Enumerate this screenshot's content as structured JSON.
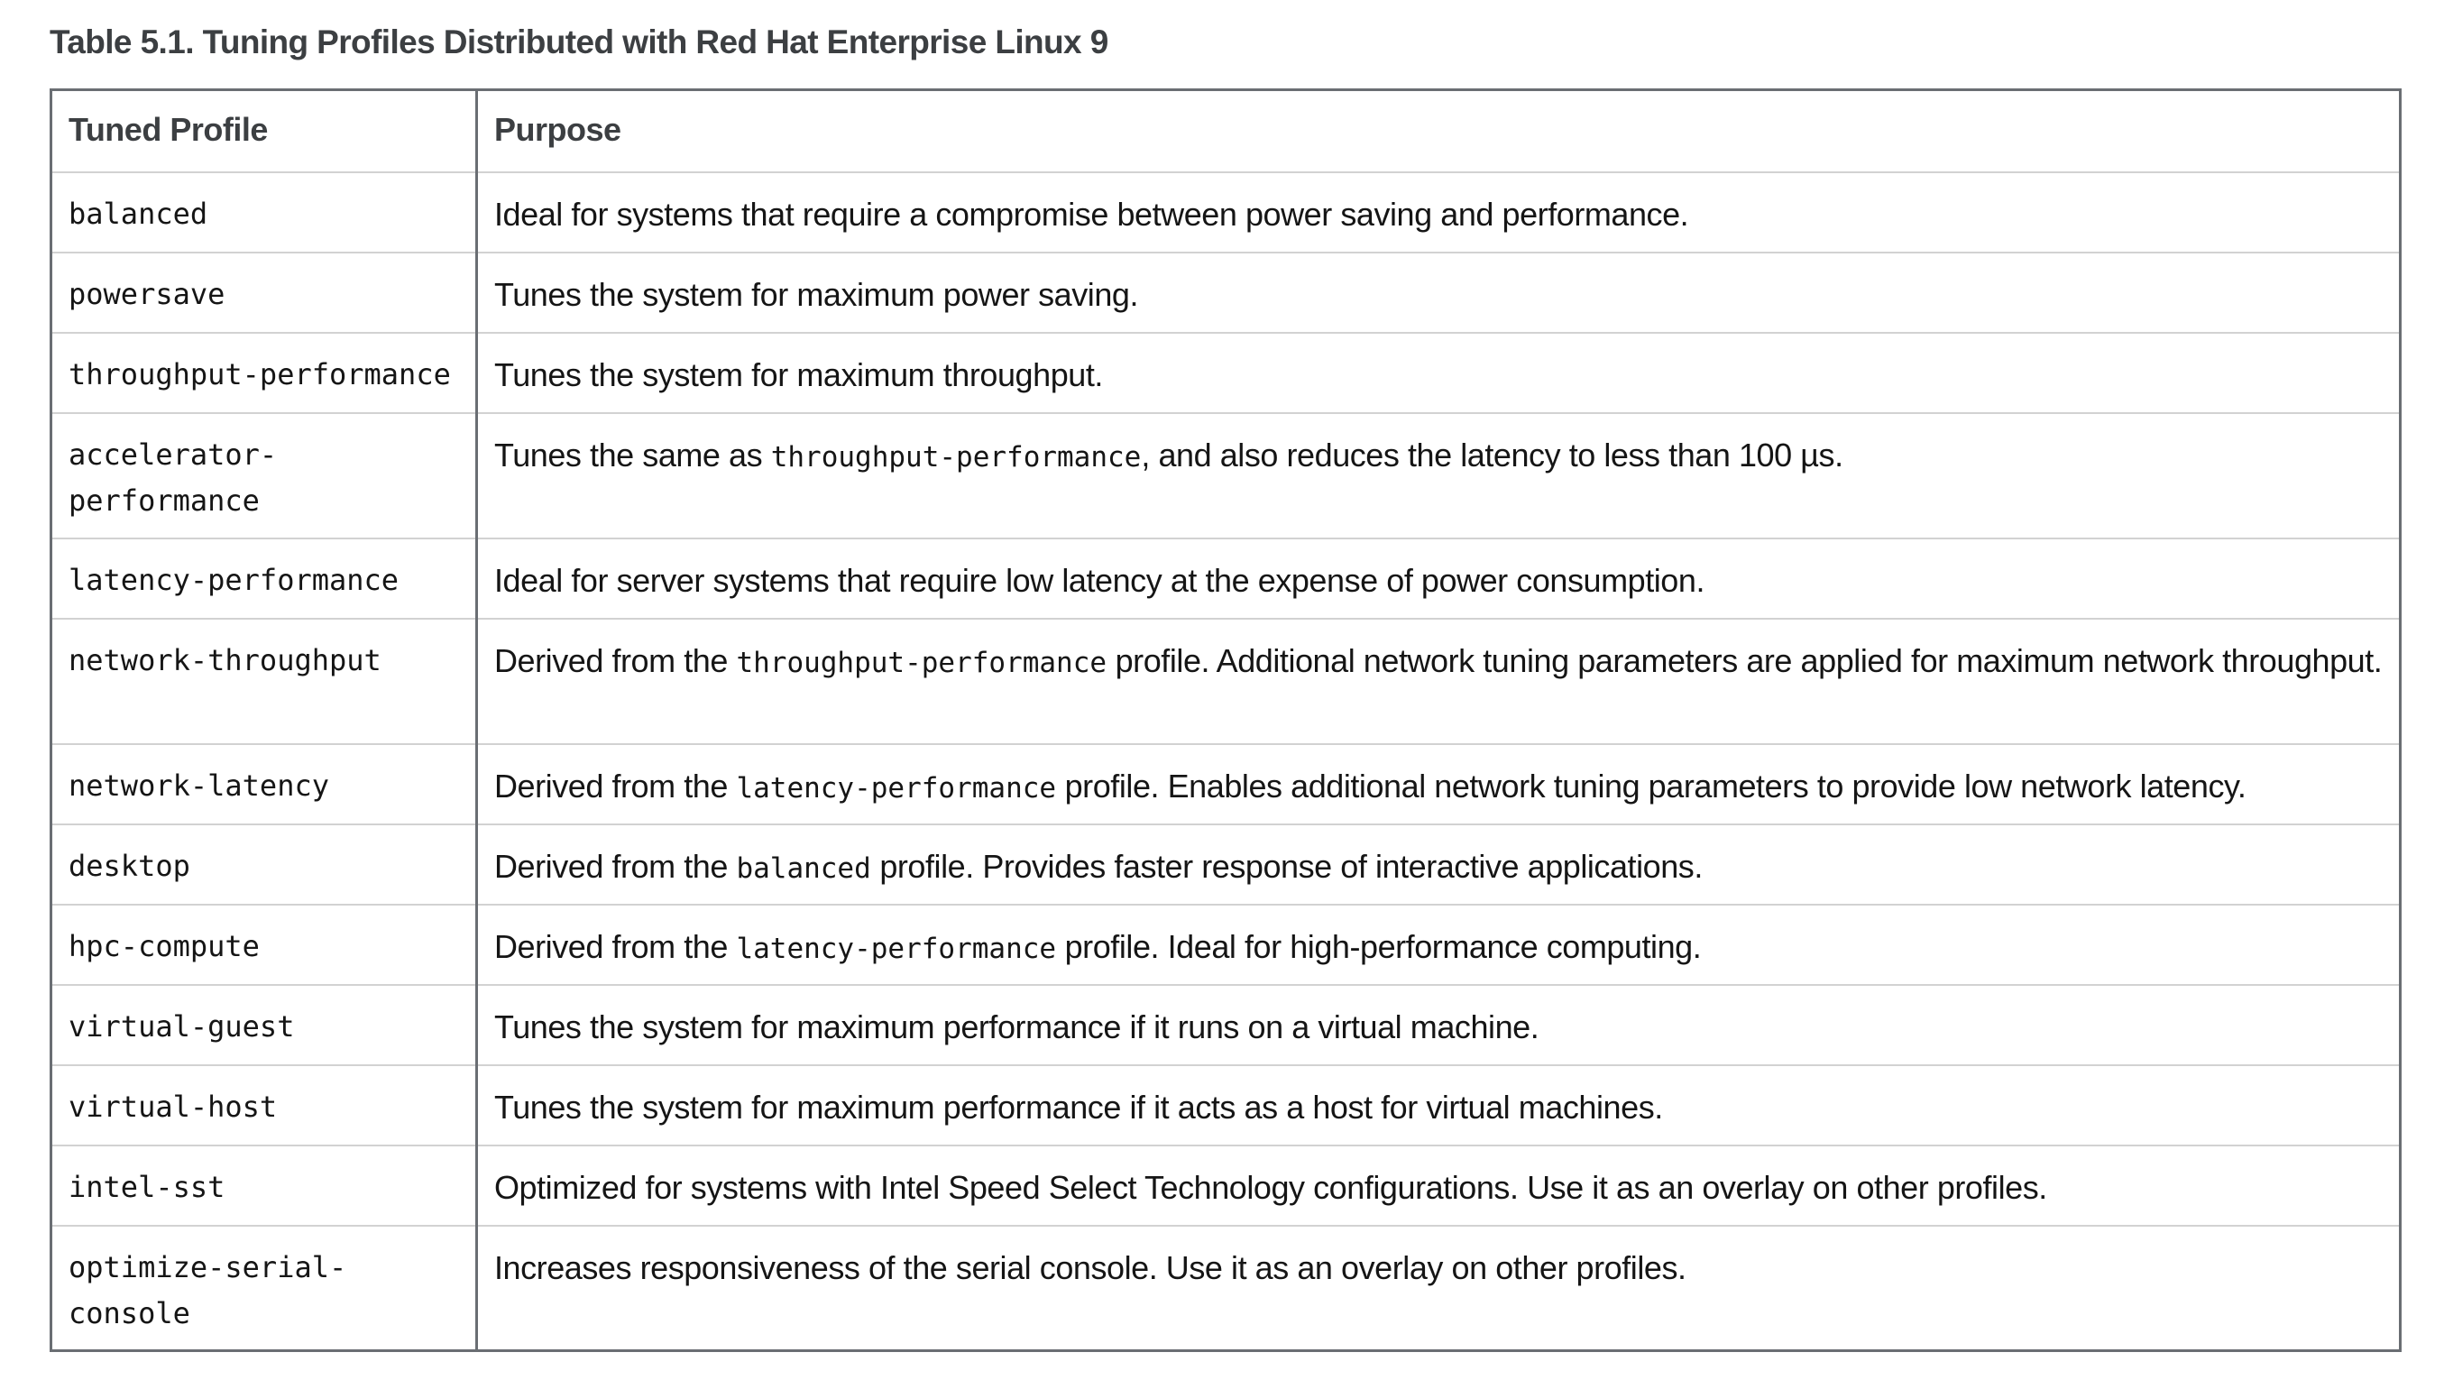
{
  "caption": "Table 5.1. Tuning Profiles Distributed with Red Hat Enterprise Linux 9",
  "table": {
    "headers": {
      "profile": "Tuned Profile",
      "purpose": "Purpose"
    },
    "rows": [
      {
        "name": "balanced",
        "purpose": "Ideal for systems that require a compromise between power saving and performance."
      },
      {
        "name": "powersave",
        "purpose": "Tunes the system for maximum power saving."
      },
      {
        "name": "throughput-performance",
        "purpose": "Tunes the system for maximum throughput."
      },
      {
        "name": "accelerator-performance",
        "purpose_pre": "Tunes the same as ",
        "purpose_code": "throughput-performance",
        "purpose_post": ", and also reduces the latency to less than 100 µs."
      },
      {
        "name": "latency-performance",
        "purpose": "Ideal for server systems that require low latency at the expense of power consumption."
      },
      {
        "name": "network-throughput",
        "purpose_pre": "Derived from the ",
        "purpose_code": "throughput-performance",
        "purpose_post": " profile. Additional network tuning parameters are applied for maximum network throughput."
      },
      {
        "name": "network-latency",
        "purpose_pre": "Derived from the ",
        "purpose_code": "latency-performance",
        "purpose_post": " profile. Enables additional network tuning parameters to provide low network latency."
      },
      {
        "name": "desktop",
        "purpose_pre": "Derived from the ",
        "purpose_code": "balanced",
        "purpose_post": " profile. Provides faster response of interactive applications."
      },
      {
        "name": "hpc-compute",
        "purpose_pre": "Derived from the ",
        "purpose_code": "latency-performance",
        "purpose_post": " profile. Ideal for high-performance computing."
      },
      {
        "name": "virtual-guest",
        "purpose": "Tunes the system for maximum performance if it runs on a virtual machine."
      },
      {
        "name": "virtual-host",
        "purpose": "Tunes the system for maximum performance if it acts as a host for virtual machines."
      },
      {
        "name": "intel-sst",
        "purpose": "Optimized for systems with Intel Speed Select Technology configurations. Use it as an overlay on other profiles."
      },
      {
        "name": "optimize-serial-console",
        "purpose": "Increases responsiveness of the serial console. Use it as an overlay on other profiles."
      }
    ]
  }
}
